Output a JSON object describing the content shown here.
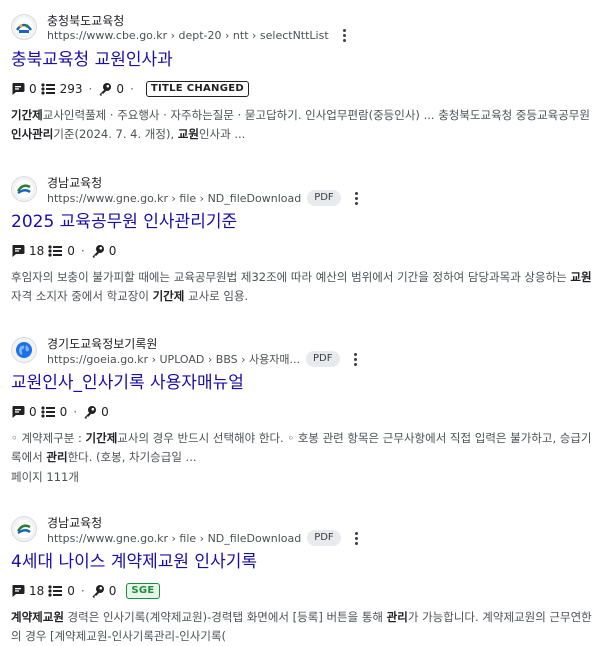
{
  "results": [
    {
      "site_name": "충청북도교육청",
      "url": "https://www.cbe.go.kr › dept-20 › ntt › selectNttList",
      "badge": "",
      "title": "충북교육청 교원인사과",
      "comments": "0",
      "lists": "293",
      "keys": "0",
      "tag": "TITLE CHANGED",
      "snippet_parts": [
        {
          "t": "기간제",
          "b": true
        },
        {
          "t": "교사인력풀제 · 주요행사 · 자주하는질문 · 묻고답하기. 인사업무편람(중등인사) ... 충청북도교육청 중등교육공무원 ",
          "b": false
        },
        {
          "t": "인사관리",
          "b": true
        },
        {
          "t": "기준(2024. 7. 4. 개정), ",
          "b": false
        },
        {
          "t": "교원",
          "b": true
        },
        {
          "t": "인사과 ...",
          "b": false
        }
      ],
      "pages": ""
    },
    {
      "site_name": "경남교육청",
      "url": "https://www.gne.go.kr › file › ND_fileDownload",
      "badge": "PDF",
      "title": "2025 교육공무원 인사관리기준",
      "comments": "18",
      "lists": "0",
      "keys": "0",
      "tag": "",
      "snippet_parts": [
        {
          "t": "후임자의 보충이 불가피할 때에는 교육공무원법 제32조에 따라 예산의 범위에서 기간을 정하여 담당과목과 상응하는 ",
          "b": false
        },
        {
          "t": "교원",
          "b": true
        },
        {
          "t": "자격 소지자 중에서 학교장이 ",
          "b": false
        },
        {
          "t": "기간제",
          "b": true
        },
        {
          "t": " 교사로 임용.",
          "b": false
        }
      ],
      "pages": ""
    },
    {
      "site_name": "경기도교육정보기록원",
      "url": "https://goeia.go.kr › UPLOAD › BBS › 사용자매...",
      "badge": "PDF",
      "title": "교원인사_인사기록 사용자매뉴얼",
      "comments": "0",
      "lists": "0",
      "keys": "0",
      "tag": "",
      "snippet_parts": [
        {
          "t": "◦ 계약제구분 : ",
          "b": false
        },
        {
          "t": "기간제",
          "b": true
        },
        {
          "t": "교사의 경우 반드시 선택해야 한다. ◦ 호봉 관련 항목은 근무사항에서 직접 입력은 불가하고, 승급기록에서 ",
          "b": false
        },
        {
          "t": "관리",
          "b": true
        },
        {
          "t": "한다. (호봉, 차기승급일 ...",
          "b": false
        }
      ],
      "pages": "페이지 111개"
    },
    {
      "site_name": "경남교육청",
      "url": "https://www.gne.go.kr › file › ND_fileDownload",
      "badge": "PDF",
      "title": "4세대 나이스 계약제교원 인사기록",
      "comments": "18",
      "lists": "0",
      "keys": "0",
      "tag": "SGE",
      "snippet_parts": [
        {
          "t": "계약제교원",
          "b": true
        },
        {
          "t": " 경력은 인사기록(계약제교원)-경력탭 화면에서 [등록] 버튼을 통해 ",
          "b": false
        },
        {
          "t": "관리",
          "b": true
        },
        {
          "t": "가 가능합니다. 계약제교원의 근무연한의 경우 [계약제교원-인사기록관리-인사기록(",
          "b": false
        }
      ],
      "pages": ""
    }
  ],
  "colors": {
    "link": "#1a0dab",
    "text": "#202124",
    "muted": "#4d5156",
    "sge": "#1e8e3e"
  }
}
